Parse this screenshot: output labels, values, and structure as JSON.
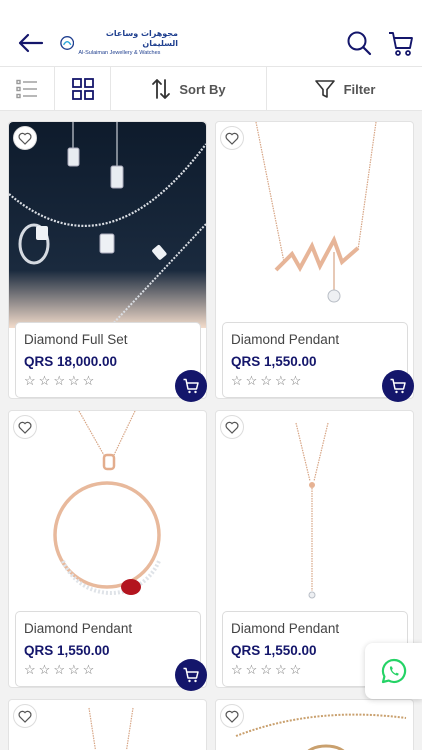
{
  "header": {
    "logo_arabic": "مجوهرات وساعات السليمان",
    "logo_english": "Al-Sulaiman Jewellery & Watches"
  },
  "toolbar": {
    "sort_label": "Sort By",
    "filter_label": "Filter"
  },
  "products": [
    {
      "name": "Diamond Full Set",
      "price": "QRS 18,000.00",
      "rating": 0
    },
    {
      "name": "Diamond Pendant",
      "price": "QRS 1,550.00",
      "rating": 0
    },
    {
      "name": "Diamond Pendant",
      "price": "QRS 1,550.00",
      "rating": 0
    },
    {
      "name": "Diamond Pendant",
      "price": "QRS 1,550.00",
      "rating": 0
    }
  ],
  "colors": {
    "brand_navy": "#14166b",
    "logo_blue": "#1f3f8f",
    "whatsapp_green": "#25d366"
  },
  "icons": [
    "back-arrow-icon",
    "search-icon",
    "cart-icon",
    "list-view-icon",
    "grid-view-icon",
    "sort-icon",
    "filter-icon",
    "heart-icon",
    "star-icon",
    "whatsapp-icon"
  ]
}
